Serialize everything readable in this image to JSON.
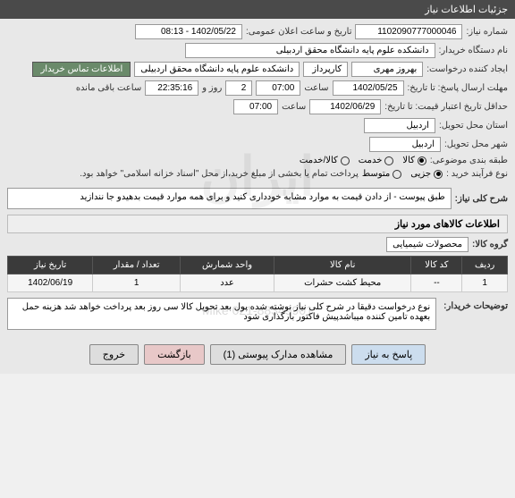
{
  "header": {
    "title": "جزئیات اطلاعات نیاز"
  },
  "form": {
    "need_no_label": "شماره نیاز:",
    "need_no": "1102090777000046",
    "public_datetime_label": "تاریخ و ساعت اعلان عمومی:",
    "public_datetime": "1402/05/22 - 08:13",
    "buyer_org_label": "نام دستگاه خریدار:",
    "buyer_org": "دانشکده علوم پایه دانشگاه محقق اردبیلی",
    "requester_label": "ایجاد کننده درخواست:",
    "requester_name": "بهروز مهری",
    "requester_role": "کارپرداز",
    "requester_org": "دانشکده علوم پایه دانشگاه محقق اردبیلی",
    "contact_btn": "اطلاعات تماس خریدار",
    "deadline_label": "مهلت ارسال پاسخ: تا تاریخ:",
    "deadline_date": "1402/05/25",
    "deadline_hour_label": "ساعت",
    "deadline_hour": "07:00",
    "day_label": "روز و",
    "days_left": "2",
    "remaining_time": "22:35:16",
    "remaining_label": "ساعت باقی مانده",
    "validity_label": "حداقل تاریخ اعتبار قیمت: تا تاریخ:",
    "validity_date": "1402/06/29",
    "validity_hour_label": "ساعت",
    "validity_hour": "07:00",
    "province_label": "استان محل تحویل:",
    "province": "اردبیل",
    "city_label": "شهر محل تحویل:",
    "city": "اردبیل",
    "category_label": "طبقه بندی موضوعی:",
    "category_options": [
      "کالا",
      "خدمت",
      "کالا/خدمت"
    ],
    "category_selected": 0,
    "process_label": "نوع فرآیند خرید :",
    "process_options": [
      "جزیی",
      "متوسط"
    ],
    "process_selected": 0,
    "process_note": "پرداخت تمام یا بخشی از مبلغ خرید،از محل \"اسناد خزانه اسلامی\" خواهد بود."
  },
  "general_desc": {
    "label": "شرح کلی نیاز:",
    "text": "طبق پیوست - از دادن قیمت به موارد مشابه خودداری کنید و برای همه موارد قیمت بدهیدو جا نندازید"
  },
  "items_header": "اطلاعات کالاهای مورد نیاز",
  "group": {
    "label": "گروه کالا:",
    "value": "محصولات شیمیایی"
  },
  "table": {
    "headers": [
      "ردیف",
      "کد کالا",
      "نام کالا",
      "واحد شمارش",
      "تعداد / مقدار",
      "تاریخ نیاز"
    ],
    "rows": [
      {
        "idx": "1",
        "code": "--",
        "name": "محیط کشت حشرات",
        "unit": "عدد",
        "qty": "1",
        "date": "1402/06/19"
      }
    ]
  },
  "buyer_notes": {
    "label": "توضیحات خریدار:",
    "text": "نوع درخواست دقیقا در شرح کلی نیاز نوشته شده پول بعد تحویل کالا سی روز بعد پرداخت خواهد شد هزینه حمل بعهده تامین کننده میباشدپیش فاکتور بارگذاری شود"
  },
  "buttons": {
    "respond": "پاسخ به نیاز",
    "attachments": "مشاهده مدارک پیوستی (1)",
    "back": "بازگشت",
    "exit": "خروج"
  },
  "watermark": "ایران",
  "sub_watermark": "Mike 021-88349901"
}
